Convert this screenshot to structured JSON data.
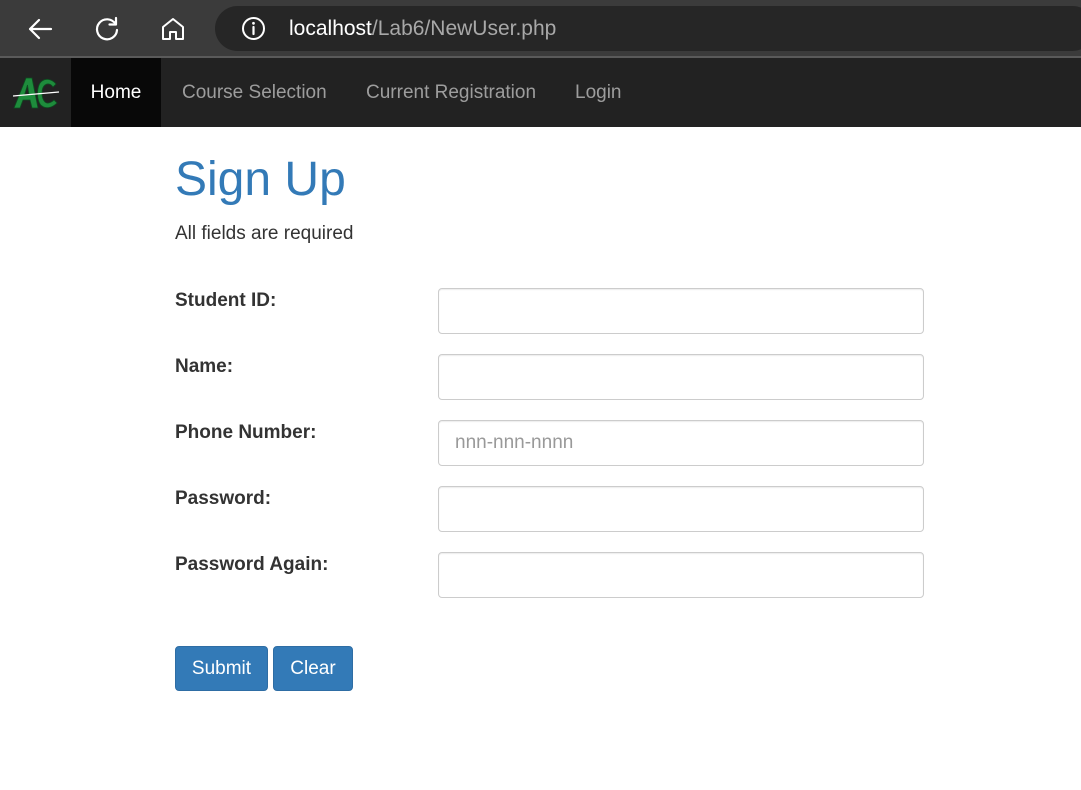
{
  "browser": {
    "url_host": "localhost",
    "url_path": "/Lab6/NewUser.php",
    "icons": [
      "back-arrow-icon",
      "reload-icon",
      "home-icon",
      "info-icon"
    ]
  },
  "navbar": {
    "brand_logo": "AC",
    "items": [
      {
        "label": "Home",
        "active": true
      },
      {
        "label": "Course Selection",
        "active": false
      },
      {
        "label": "Current Registration",
        "active": false
      },
      {
        "label": "Login",
        "active": false
      }
    ]
  },
  "form": {
    "title": "Sign Up",
    "subtitle": "All fields are required",
    "fields": [
      {
        "label": "Student ID:",
        "value": "",
        "placeholder": ""
      },
      {
        "label": "Name:",
        "value": "",
        "placeholder": ""
      },
      {
        "label": "Phone Number:",
        "value": "",
        "placeholder": "nnn-nnn-nnnn"
      },
      {
        "label": "Password:",
        "value": "",
        "placeholder": ""
      },
      {
        "label": "Password Again:",
        "value": "",
        "placeholder": ""
      }
    ],
    "submit_label": "Submit",
    "clear_label": "Clear"
  },
  "colors": {
    "accent": "#337ab7",
    "navbar_bg": "#222222",
    "brand_green": "#1e8c3c"
  }
}
